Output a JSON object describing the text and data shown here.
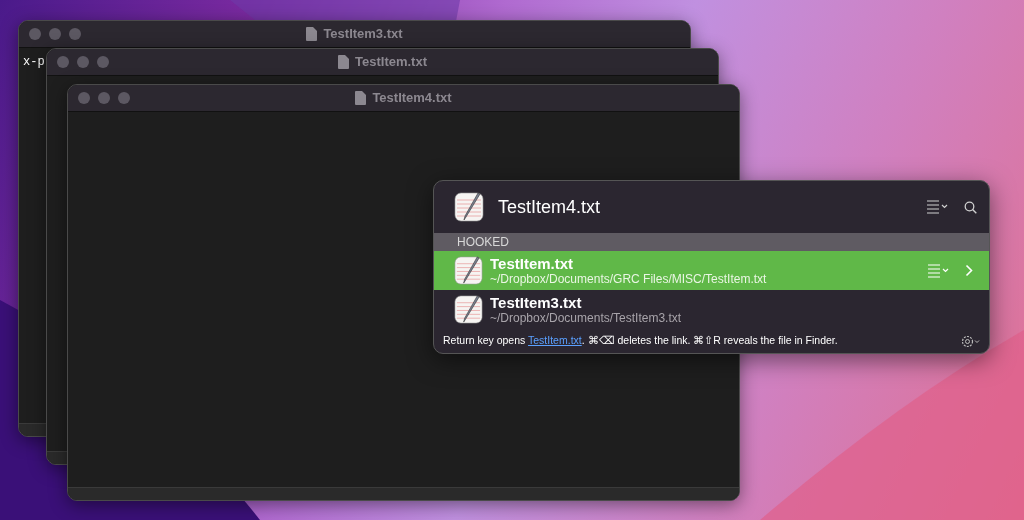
{
  "windows": [
    {
      "title": "TestItem3.txt",
      "content": "x-p"
    },
    {
      "title": "TestItem.txt"
    },
    {
      "title": "TestItem4.txt"
    }
  ],
  "popup": {
    "title": "TestItem4.txt",
    "section": "HOOKED",
    "items": [
      {
        "name": "TestItem.txt",
        "path": "~/Dropbox/Documents/GRC Files/MISC/TestItem.txt",
        "selected": true
      },
      {
        "name": "TestItem3.txt",
        "path": "~/Dropbox/Documents/TestItem3.txt",
        "selected": false
      }
    ],
    "footer": {
      "before": "Return key opens ",
      "link": "TestItem.txt",
      "after": ". ⌘⌫ deletes the link. ⌘⇧R reveals the file in Finder."
    }
  }
}
